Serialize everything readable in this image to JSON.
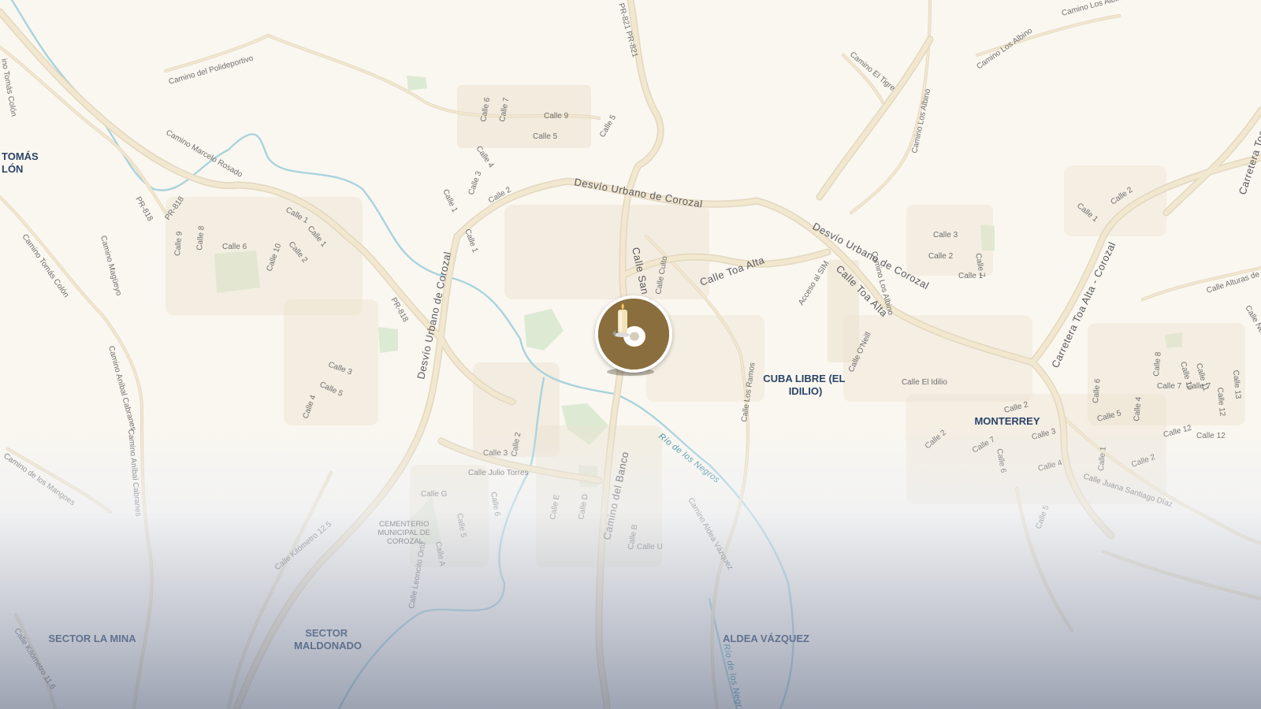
{
  "map": {
    "area_labels": {
      "tomas_colon": "TOMÁS\nLÓN",
      "cuba_libre": "CUBA LIBRE (EL\nIDILIO)",
      "monterrey": "MONTERREY",
      "sector_la_mina": "SECTOR LA MINA",
      "sector_maldonado": "SECTOR\nMALDONADO",
      "aldea_vazquez": "ALDEA VÁZQUEZ",
      "cementerio": "CEMENTERIO\nMUNICIPAL DE\nCOROZAL"
    },
    "major_roads": {
      "desvio_1": "Desvío Urbano de Corozal",
      "desvio_2": "Desvío Urbano de Corozal",
      "desvio_3": "Desvío Urbano de Corozal",
      "toa_alta_corozal": "Carretera Toa Alta - Corozal",
      "toa_alta_top": "Carretera Toa A"
    },
    "water_labels": {
      "rio_1": "Río de los Negros",
      "rio_2": "Río de los Negr"
    },
    "street_labels": {
      "pr821": "PR-821 PR-821",
      "pr818_a": "PR-818",
      "pr818_b": "PR-818",
      "pr818_c": "PR-818",
      "polideportivo": "Camino del Polideportivo",
      "marcelo_rosado": "Camino Marcelo Rosado",
      "tomas_colon_top": "ino Tomás Colón",
      "tomas_colon": "Camino Tomás Colón",
      "magueyo": "Camino Magüeyo",
      "anibal_cabranes_1": "Camino Aníbal Cabranes",
      "anibal_cabranes_2": "Camino Aníbal Cabranes",
      "de_los_mangoes": "Camino de los Mangoes",
      "kilometro_12_5": "Calle Kilómetro 12.5",
      "kilometro_11_6": "Calle Kilómetro 11.6",
      "leoncito_ortiz": "Calle Leoncito Ortiz",
      "julio_torres": "Calle Julio Torres",
      "calle_g": "Calle G",
      "calle_a": "Calle A",
      "calle_e": "Calle E",
      "calle_d": "Calle D",
      "calle_b": "Calle B",
      "calle_u": "Calle U",
      "camino_del_banco": "Camino del Banco",
      "aldea_vazquez_road": "Camino Aldea Vázquez",
      "calle_san": "Calle San J",
      "calle_culto": "Calle Culto",
      "toa_alta_1": "Calle Toa Alta",
      "toa_alta_2": "Calle Toa Alta",
      "acceso_sim": "Acceso al SIM",
      "los_albino_1": "Camino Los Albino",
      "los_albino_2": "Camino Los Albino",
      "los_albino_3": "Camino Los Albino",
      "los_albino_4": "Camino Los Albino",
      "el_tigre": "Camino El Tigre",
      "oneill": "Calle O'Neill",
      "el_idilio": "Calle El Idilio",
      "los_ramos": "Calle Los Ramos",
      "alturas": "Calle Alturas de",
      "juana_santiago": "Calle Juana Santiago Díaz",
      "calle_ne": "Calle Ne",
      "c9": "Calle 9",
      "c5": "Calle 5",
      "c6": "Calle 6",
      "c7": "Calle 7",
      "c4": "Calle 4",
      "c3": "Calle 3",
      "c2": "Calle 2",
      "c1": "Calle 1",
      "c10": "Calle 10",
      "c8": "Calle 8",
      "c11": "Calle 11",
      "c12": "Calle 12",
      "c13": "Calle 13"
    },
    "marker": {
      "name": "candle-memorial",
      "color": "#8a6e3d"
    }
  }
}
